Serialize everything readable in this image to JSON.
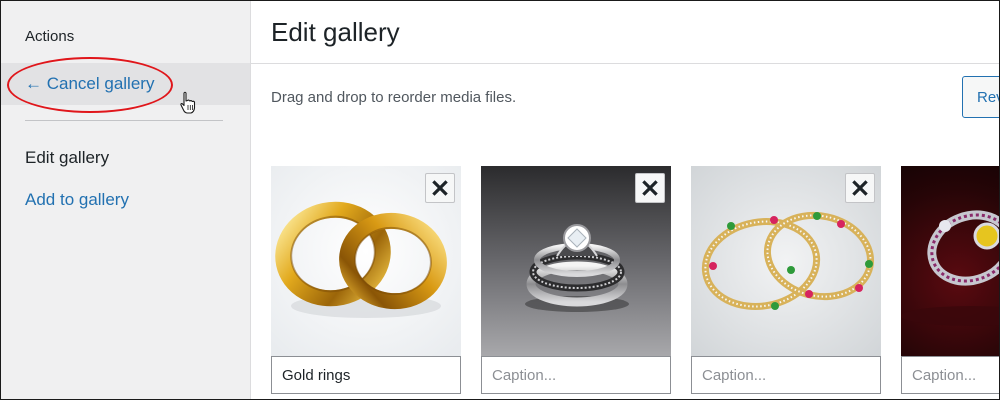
{
  "sidebar": {
    "heading": "Actions",
    "cancel_label": "← Cancel gallery",
    "edit_label": "Edit gallery",
    "add_label": "Add to gallery"
  },
  "main": {
    "title": "Edit gallery",
    "instructions": "Drag and drop to reorder media files.",
    "reverse_button": "Rev"
  },
  "gallery": [
    {
      "caption_value": "Gold rings",
      "caption_placeholder": "Caption...",
      "image": "gold-wedding-rings"
    },
    {
      "caption_value": "",
      "caption_placeholder": "Caption...",
      "image": "diamond-ring-set"
    },
    {
      "caption_value": "",
      "caption_placeholder": "Caption...",
      "image": "gemstone-bangles"
    },
    {
      "caption_value": "",
      "caption_placeholder": "Caption...",
      "image": "jeweled-ring-dark"
    }
  ],
  "colors": {
    "link": "#2271b1",
    "annotation": "#e0161b",
    "sidebar_bg": "#f0f0f1"
  }
}
